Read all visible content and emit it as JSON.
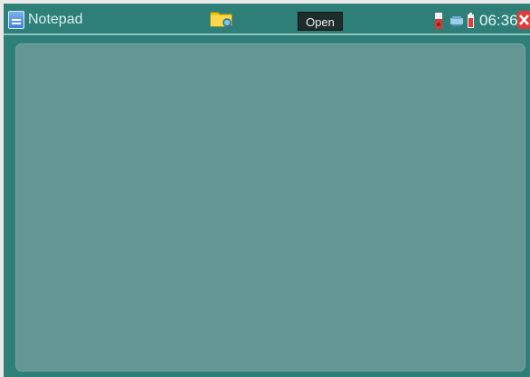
{
  "app": {
    "title": "Notepad",
    "app_icon": "notepad-icon"
  },
  "toolbar": {
    "folder_icon": "folder-search-icon",
    "open_label": "Open"
  },
  "status_bar": {
    "icons": [
      "sd-card-icon",
      "network-icon",
      "battery-icon"
    ],
    "time": "06:36",
    "close_icon": "close-icon"
  },
  "colors": {
    "frame": "#2f7f79",
    "content_area": "#649693",
    "close": "#e23b3b",
    "button": "#1e2c2c"
  },
  "editor": {
    "text": ""
  }
}
